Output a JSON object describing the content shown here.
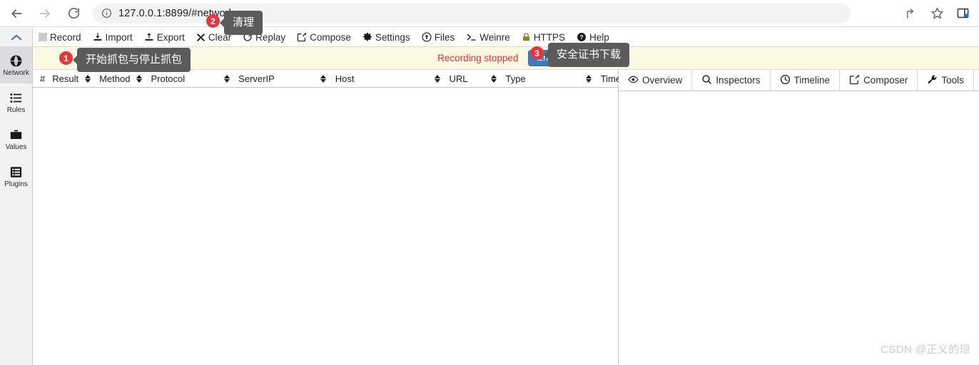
{
  "browser": {
    "back_label": "Back",
    "forward_label": "Forward",
    "reload_label": "Reload",
    "url": "127.0.0.1:8899/#network",
    "site_info_icon": "info-circle-icon",
    "share_label": "Share",
    "bookmark_label": "Bookmark this tab",
    "sidepanel_label": "Side panel"
  },
  "rail": {
    "collapse_label": "Collapse",
    "items": [
      {
        "label": "Network",
        "icon": "globe-icon",
        "active": true
      },
      {
        "label": "Rules",
        "icon": "list-icon",
        "active": false
      },
      {
        "label": "Values",
        "icon": "briefcase-icon",
        "active": false
      },
      {
        "label": "Plugins",
        "icon": "plugin-list-icon",
        "active": false
      }
    ]
  },
  "toolbar": {
    "items": [
      {
        "label": "Record",
        "icon": "record-checkbox-icon"
      },
      {
        "label": "Import",
        "icon": "import-icon"
      },
      {
        "label": "Export",
        "icon": "export-icon"
      },
      {
        "label": "Clear",
        "icon": "cross-icon"
      },
      {
        "label": "Replay",
        "icon": "replay-icon"
      },
      {
        "label": "Compose",
        "icon": "compose-icon"
      },
      {
        "label": "Settings",
        "icon": "gear-icon"
      },
      {
        "label": "Files",
        "icon": "upload-circle-icon"
      },
      {
        "label": "Weinre",
        "icon": "terminal-icon"
      },
      {
        "label": "HTTPS",
        "icon": "lock-icon"
      },
      {
        "label": "Help",
        "icon": "question-circle-icon"
      }
    ]
  },
  "statusbar": {
    "recording_status": "Recording stopped",
    "enable_label": "Enable",
    "status_color": "#e03131",
    "background": "#fcf9e3"
  },
  "annotations": [
    {
      "number": "1",
      "text": "开始抓包与停止抓包"
    },
    {
      "number": "2",
      "text": "清理"
    },
    {
      "number": "3",
      "text": "安全证书下载"
    }
  ],
  "table": {
    "columns": [
      {
        "label": "#",
        "sortable": false
      },
      {
        "label": "Result",
        "sortable": true
      },
      {
        "label": "Method",
        "sortable": true
      },
      {
        "label": "Protocol",
        "sortable": true
      },
      {
        "label": "ServerIP",
        "sortable": true
      },
      {
        "label": "Host",
        "sortable": true
      },
      {
        "label": "URL",
        "sortable": true
      },
      {
        "label": "Type",
        "sortable": true
      },
      {
        "label": "Time",
        "sortable": true
      }
    ],
    "rows": []
  },
  "right_panel": {
    "tabs": [
      {
        "label": "Overview",
        "icon": "eye-icon"
      },
      {
        "label": "Inspectors",
        "icon": "search-icon"
      },
      {
        "label": "Timeline",
        "icon": "clock-icon"
      },
      {
        "label": "Composer",
        "icon": "compose-icon"
      },
      {
        "label": "Tools",
        "icon": "wrench-icon"
      }
    ]
  },
  "watermark": {
    "text": "CSDN @正义的琼"
  }
}
